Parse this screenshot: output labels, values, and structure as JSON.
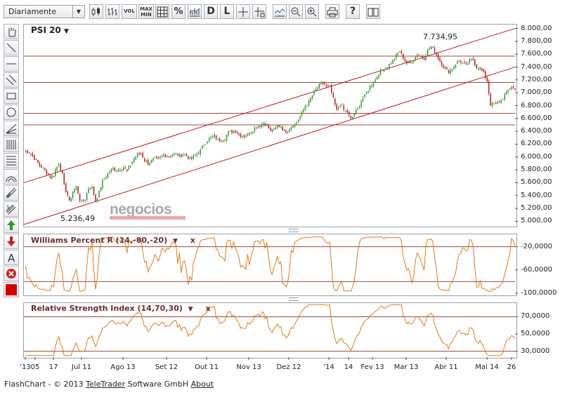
{
  "toolbar": {
    "period": "Diariamente",
    "vol": "VOL",
    "max": "MAX",
    "min": "MIN",
    "percent": "%",
    "d": "D",
    "l": "L",
    "help": "?"
  },
  "colors": {
    "up": "#2e9a2e",
    "down": "#b01e1e",
    "channel": "#c8141e",
    "oscillator": "#e07a1e",
    "level": "#9b4a3a",
    "panel_title": "#6e2c2c",
    "logo": "#a0a0a0",
    "logo_bar": "#e8a0a0"
  },
  "main": {
    "symbol": "PSI 20",
    "symbol_arrow": "▼",
    "high_label": "7.734,95",
    "low_label": "5.236,49",
    "logo": "negocios",
    "y_ticks": [
      "8.000,00",
      "7.800,00",
      "7.600,00",
      "7.400,00",
      "7.200,00",
      "7.000,00",
      "6.800,00",
      "6.600,00",
      "6.400,00",
      "6.200,00",
      "6.000,00",
      "5.800,00",
      "5.600,00",
      "5.400,00",
      "5.200,00",
      "5.000,00"
    ]
  },
  "williams": {
    "title": "Williams Percent R (14,-80,-20)",
    "arrow": "▼",
    "close": "x",
    "y_ticks": [
      "-20,0000",
      "-60,0000",
      "-100,0000"
    ]
  },
  "rsi": {
    "title": "Relative Strength Index (14,70,30)",
    "arrow": "▼",
    "close": "x",
    "y_ticks": [
      "70,0000",
      "50,0000",
      "30,0000"
    ]
  },
  "x_ticks": [
    "'13",
    "05",
    "17",
    "Jul 11",
    "Ago 13",
    "Set 12",
    "Out 11",
    "Nov 13",
    "Dez 12",
    "'14",
    "14",
    "Fev 13",
    "Mar 13",
    "Abr 11",
    "Mai 14",
    "26"
  ],
  "footer": {
    "prefix": "FlashChart - © 2013",
    "company": "TeleTrader",
    "suffix": "Software GmbH",
    "about": "About"
  },
  "chart_data": [
    {
      "type": "candlestick",
      "title": "PSI 20",
      "x_ticks": [
        "'13",
        "05",
        "17",
        "Jul 11",
        "Ago 13",
        "Set 12",
        "Out 11",
        "Nov 13",
        "Dez 12",
        "'14",
        "14",
        "Fev 13",
        "Mar 13",
        "Abr 11",
        "Mai 14",
        "26"
      ],
      "ylim": [
        4950,
        8050
      ],
      "close_path": [
        [
          0,
          6100
        ],
        [
          3,
          6080
        ],
        [
          6,
          5980
        ],
        [
          9,
          5870
        ],
        [
          11,
          5820
        ],
        [
          13,
          5760
        ],
        [
          15,
          5690
        ],
        [
          17,
          5720
        ],
        [
          18,
          5800
        ],
        [
          20,
          5900
        ],
        [
          22,
          5720
        ],
        [
          23,
          5550
        ],
        [
          25,
          5400
        ],
        [
          26,
          5300
        ],
        [
          28,
          5460
        ],
        [
          30,
          5540
        ],
        [
          32,
          5340
        ],
        [
          33,
          5300
        ],
        [
          35,
          5350
        ],
        [
          37,
          5520
        ],
        [
          39,
          5520
        ],
        [
          41,
          5320
        ],
        [
          43,
          5450
        ],
        [
          45,
          5620
        ],
        [
          47,
          5700
        ],
        [
          49,
          5780
        ],
        [
          51,
          5820
        ],
        [
          53,
          5800
        ],
        [
          55,
          5820
        ],
        [
          57,
          5840
        ],
        [
          59,
          5780
        ],
        [
          61,
          5880
        ],
        [
          63,
          5980
        ],
        [
          65,
          6040
        ],
        [
          67,
          6060
        ],
        [
          69,
          5950
        ],
        [
          71,
          5900
        ],
        [
          73,
          5940
        ],
        [
          75,
          5980
        ],
        [
          77,
          5960
        ],
        [
          79,
          6020
        ],
        [
          81,
          6020
        ],
        [
          83,
          6010
        ],
        [
          85,
          6050
        ],
        [
          87,
          6050
        ],
        [
          89,
          6020
        ],
        [
          91,
          6040
        ],
        [
          93,
          6020
        ],
        [
          95,
          5960
        ],
        [
          97,
          6000
        ],
        [
          99,
          6050
        ],
        [
          101,
          6100
        ],
        [
          103,
          6200
        ],
        [
          105,
          6260
        ],
        [
          107,
          6300
        ],
        [
          109,
          6330
        ],
        [
          111,
          6260
        ],
        [
          113,
          6270
        ],
        [
          115,
          6300
        ],
        [
          117,
          6380
        ],
        [
          119,
          6400
        ],
        [
          121,
          6410
        ],
        [
          123,
          6350
        ],
        [
          125,
          6330
        ],
        [
          127,
          6330
        ],
        [
          129,
          6380
        ],
        [
          131,
          6420
        ],
        [
          133,
          6480
        ],
        [
          135,
          6490
        ],
        [
          137,
          6530
        ],
        [
          139,
          6500
        ],
        [
          141,
          6410
        ],
        [
          143,
          6420
        ],
        [
          145,
          6480
        ],
        [
          147,
          6480
        ],
        [
          149,
          6390
        ],
        [
          151,
          6420
        ],
        [
          153,
          6480
        ],
        [
          155,
          6500
        ],
        [
          157,
          6590
        ],
        [
          159,
          6680
        ],
        [
          161,
          6800
        ],
        [
          163,
          6850
        ],
        [
          165,
          6960
        ],
        [
          167,
          7050
        ],
        [
          169,
          7110
        ],
        [
          171,
          7150
        ],
        [
          173,
          7100
        ],
        [
          175,
          7100
        ],
        [
          177,
          6900
        ],
        [
          179,
          6720
        ],
        [
          181,
          6820
        ],
        [
          183,
          6730
        ],
        [
          185,
          6700
        ],
        [
          187,
          6580
        ],
        [
          189,
          6680
        ],
        [
          191,
          6750
        ],
        [
          193,
          6880
        ],
        [
          195,
          6950
        ],
        [
          197,
          7050
        ],
        [
          199,
          7130
        ],
        [
          201,
          7200
        ],
        [
          203,
          7300
        ],
        [
          205,
          7360
        ],
        [
          207,
          7380
        ],
        [
          209,
          7440
        ],
        [
          211,
          7500
        ],
        [
          213,
          7580
        ],
        [
          215,
          7640
        ],
        [
          217,
          7550
        ],
        [
          219,
          7460
        ],
        [
          221,
          7460
        ],
        [
          223,
          7520
        ],
        [
          225,
          7600
        ],
        [
          227,
          7560
        ],
        [
          229,
          7540
        ],
        [
          231,
          7660
        ],
        [
          233,
          7720
        ],
        [
          235,
          7650
        ],
        [
          237,
          7540
        ],
        [
          239,
          7450
        ],
        [
          241,
          7370
        ],
        [
          243,
          7330
        ],
        [
          245,
          7380
        ],
        [
          247,
          7450
        ],
        [
          249,
          7500
        ],
        [
          251,
          7460
        ],
        [
          253,
          7430
        ],
        [
          255,
          7500
        ],
        [
          257,
          7510
        ],
        [
          259,
          7400
        ],
        [
          261,
          7380
        ],
        [
          263,
          7300
        ],
        [
          265,
          7180
        ],
        [
          267,
          6820
        ],
        [
          269,
          6820
        ],
        [
          271,
          6840
        ],
        [
          273,
          6880
        ],
        [
          275,
          6960
        ],
        [
          277,
          7040
        ],
        [
          279,
          7100
        ],
        [
          281,
          7050
        ]
      ],
      "trendlines": [
        {
          "name": "channel-top",
          "from": [
            0,
            5600
          ],
          "to": [
            281,
            8000
          ]
        },
        {
          "name": "channel-bottom",
          "from": [
            0,
            4950
          ],
          "to": [
            281,
            7400
          ]
        }
      ],
      "horizontal_levels": [
        7570,
        7160,
        6680,
        6500
      ],
      "annotations": [
        {
          "text": "7.734,95",
          "at": "max"
        },
        {
          "text": "5.236,49",
          "at": "min"
        }
      ]
    },
    {
      "type": "line",
      "title": "Williams Percent R (14,-80,-20)",
      "ylim": [
        -100,
        0
      ],
      "levels": [
        -20,
        -80
      ],
      "y_ticks": [
        -20,
        -60,
        -100
      ],
      "shape": "oscillating between -100 and 0 with frequent swings, ending near -40"
    },
    {
      "type": "line",
      "title": "Relative Strength Index (14,70,30)",
      "ylim": [
        24,
        85
      ],
      "levels": [
        70,
        30
      ],
      "y_ticks": [
        70,
        50,
        30
      ],
      "shape": "mostly 40-70, peaks ~80 in January, dip to ~28 in late May, ending ~50"
    }
  ]
}
